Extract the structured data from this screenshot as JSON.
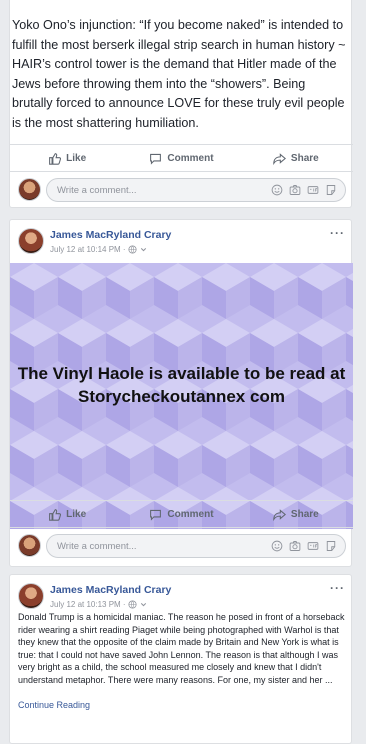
{
  "post1": {
    "text": "Yoko Ono’s injunction:  “If you become naked” is intended to fulfill the most berserk illegal strip search in human history ~ HAIR’s control tower is the demand that Hitler made of the Jews before throwing them into the “showers”.   Being brutally forced to announce LOVE for these truly evil people is the most shattering humiliation.",
    "actions": {
      "like": "Like",
      "comment": "Comment",
      "share": "Share"
    },
    "comment_placeholder": "Write a comment..."
  },
  "post2": {
    "author": "James MacRyland Crary",
    "timestamp": "July 12 at 10:14 PM · ",
    "more": "···",
    "image_text": "The Vinyl Haole is available to be read at Storycheckoutannex com",
    "actions": {
      "like": "Like",
      "comment": "Comment",
      "share": "Share"
    },
    "comment_placeholder": "Write a comment..."
  },
  "post3": {
    "author": "James MacRyland Crary",
    "timestamp": "July 12 at 10:13 PM · ",
    "more": "···",
    "text": "Donald Trump is a homicidal maniac. The reason he posed in front of a horseback rider wearing a shirt reading Piaget while being photographed with Warhol is that they knew that the opposite of the claim made by Britain and New York is what is true: that I could not have saved John Lennon. The reason is that although I was very bright as a child, the school measured me closely and knew that I didn't understand metaphor. There were many reasons. For one, my sister and her ...",
    "continue": "Continue Reading"
  },
  "colors": {
    "link": "#385898",
    "image_bg": "#bfb9ec",
    "icon": "#606770"
  },
  "icons": [
    "thumbs-up-icon",
    "comment-icon",
    "share-icon",
    "globe-icon",
    "emoji-icon",
    "camera-icon",
    "gif-icon",
    "sticker-icon"
  ]
}
